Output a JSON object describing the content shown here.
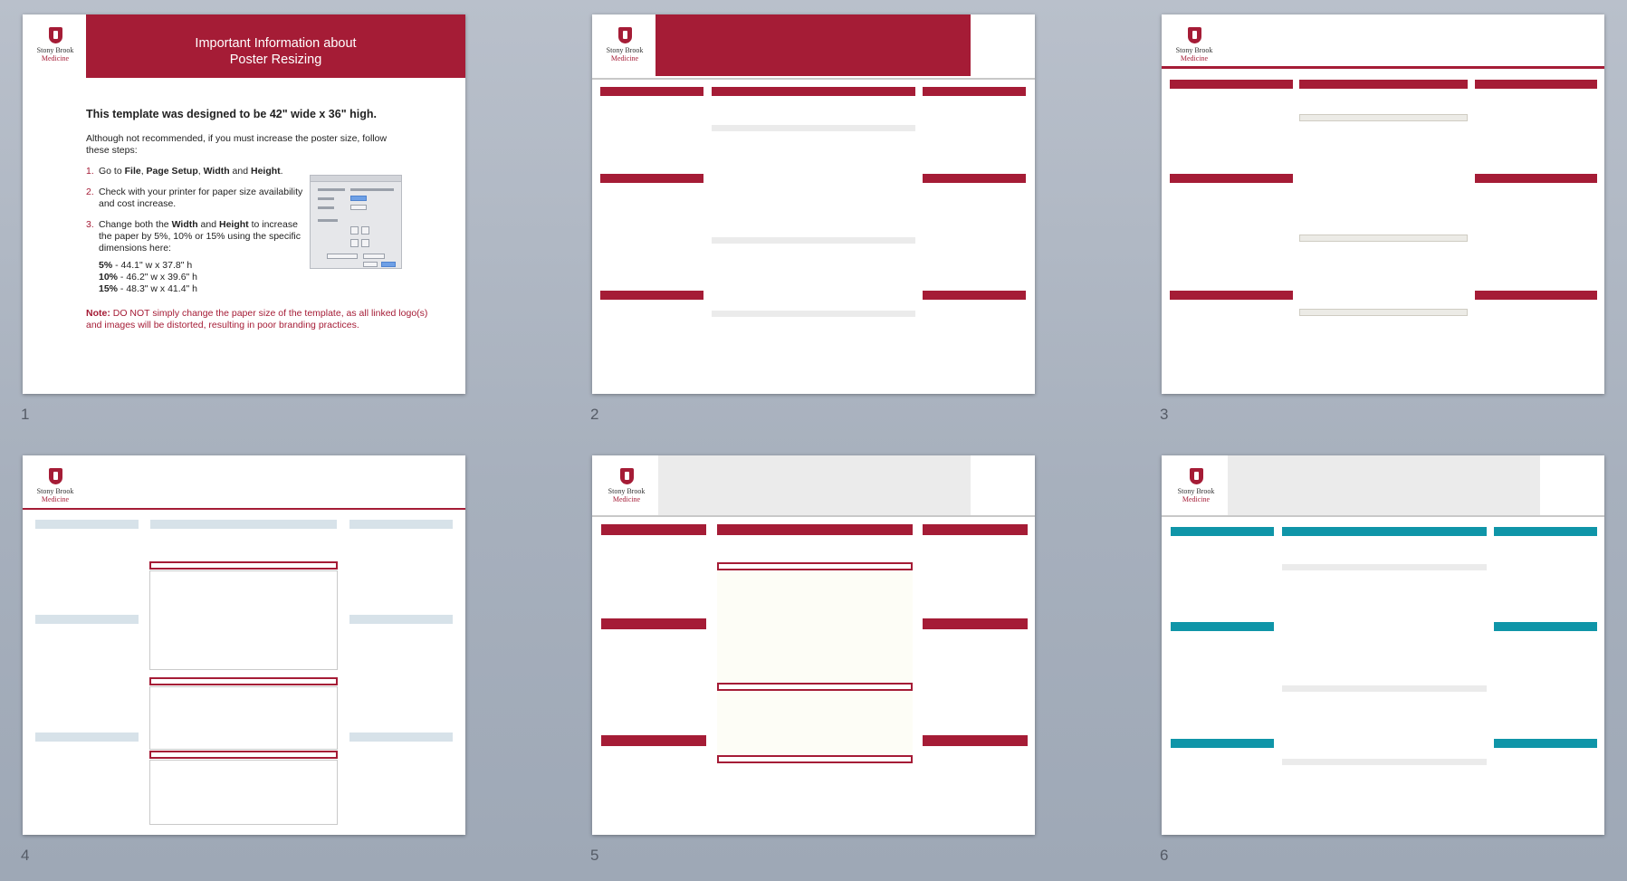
{
  "slides": [
    {
      "number": "1"
    },
    {
      "number": "2"
    },
    {
      "number": "3"
    },
    {
      "number": "4"
    },
    {
      "number": "5"
    },
    {
      "number": "6"
    }
  ],
  "logo": {
    "line1": "Stony Brook",
    "line2": "Medicine"
  },
  "slide1": {
    "header_line1": "Important Information about",
    "header_line2": "Poster Resizing",
    "title": "This template was designed to be 42\" wide x 36\" high.",
    "intro": "Although not recommended, if you must increase the poster size, follow these steps:",
    "step1_num": "1.",
    "step1_a": "Go to ",
    "step1_b": "File",
    "step1_c": ", ",
    "step1_d": "Page Setup",
    "step1_e": ", ",
    "step1_f": "Width",
    "step1_g": " and ",
    "step1_h": "Height",
    "step1_i": ".",
    "step2_num": "2.",
    "step2": "Check with your printer for paper size availability and cost increase.",
    "step3_num": "3.",
    "step3_a": "Change both the ",
    "step3_b": "Width",
    "step3_c": " and ",
    "step3_d": "Height",
    "step3_e": " to increase the paper by 5%, 10% or 15% using the specific dimensions here:",
    "dim1_pct": "5%",
    "dim1": " - 44.1\" w x 37.8\" h",
    "dim2_pct": "10%",
    "dim2": " - 46.2\" w x 39.6\" h",
    "dim3_pct": "15%",
    "dim3": " - 48.3\" w x 41.4\" h",
    "note_label": "Note:",
    "note": " DO NOT simply change the paper size of the template, as all linked logo(s) and images will be distorted, resulting in poor branding practices."
  },
  "colors": {
    "brand_red": "#a51c36",
    "light_gray": "#ebebeb",
    "light_blue": "#d7e2e9",
    "teal": "#0f95a8",
    "background": "#a9b2bf"
  }
}
